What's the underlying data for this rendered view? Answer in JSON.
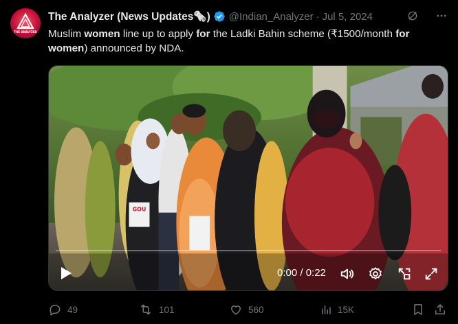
{
  "tweet": {
    "author_name": "The Analyzer (News Updates🗞️)",
    "handle": "@Indian_Analyzer",
    "separator": "·",
    "date": "Jul 5, 2024",
    "avatar_text": "THE ANALYZER",
    "text_segments": [
      {
        "t": "Muslim ",
        "bold": false
      },
      {
        "t": "women",
        "bold": true
      },
      {
        "t": " line up to apply ",
        "bold": false
      },
      {
        "t": "for",
        "bold": true
      },
      {
        "t": " the Ladki Bahin scheme (₹1500/month ",
        "bold": false
      },
      {
        "t": "for women",
        "bold": true
      },
      {
        "t": ") announced by NDA.",
        "bold": false
      }
    ]
  },
  "video": {
    "current_time": "0:00",
    "separator": " / ",
    "duration": "0:22",
    "time_display": "0:00 / 0:22",
    "sign_text": "GOU"
  },
  "actions": {
    "replies": "49",
    "reposts": "101",
    "likes": "560",
    "views": "15K"
  },
  "colors": {
    "background": "#000000",
    "text": "#e7e9ea",
    "muted": "#71767b",
    "verified": "#1d9bf0",
    "avatar": "#d81b3f"
  },
  "icons": {
    "header": [
      "grok-icon",
      "more-icon"
    ],
    "video": [
      "play-icon",
      "volume-icon",
      "settings-icon",
      "picture-in-picture-icon",
      "fullscreen-icon"
    ],
    "actions": [
      "reply-icon",
      "repost-icon",
      "like-icon",
      "views-icon",
      "bookmark-icon",
      "share-icon"
    ]
  }
}
